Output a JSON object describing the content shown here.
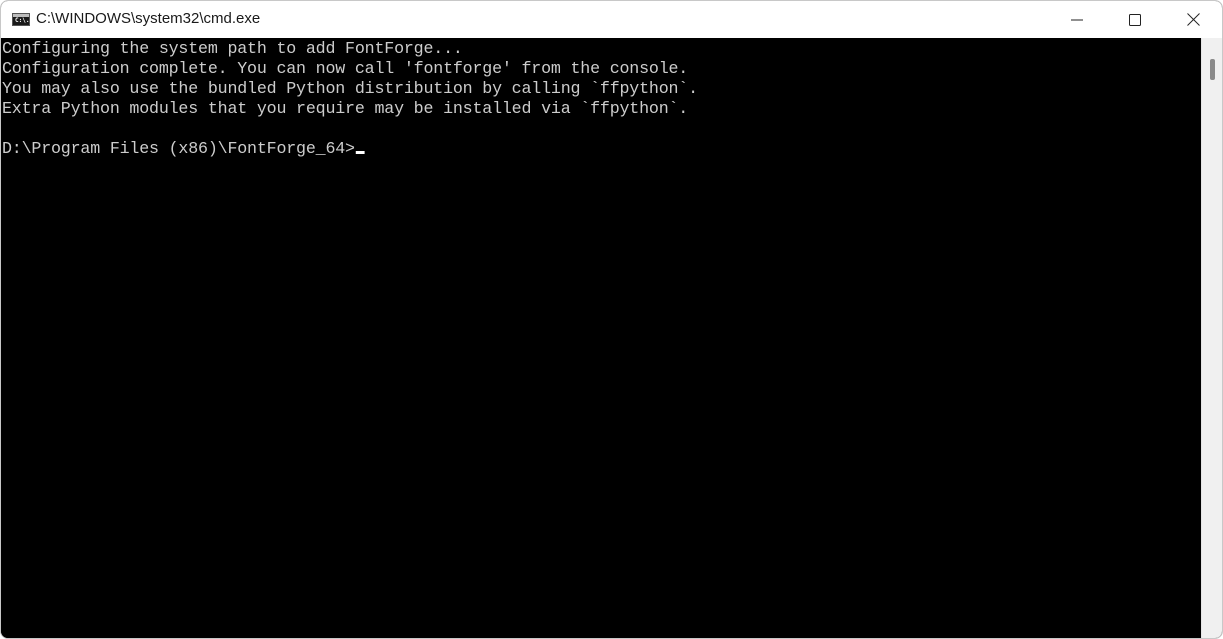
{
  "window": {
    "title": "C:\\WINDOWS\\system32\\cmd.exe",
    "app_icon": "cmd-app-icon",
    "app_icon_text": "C:\\.",
    "controls": {
      "minimize": "minimize-icon",
      "maximize": "maximize-icon",
      "close": "close-icon"
    }
  },
  "console": {
    "lines": [
      "Configuring the system path to add FontForge...",
      "Configuration complete. You can now call 'fontforge' from the console.",
      "You may also use the bundled Python distribution by calling `ffpython`.",
      "Extra Python modules that you require may be installed via `ffpython`.",
      ""
    ],
    "prompt": "D:\\Program Files (x86)\\FontForge_64>",
    "input": ""
  },
  "colors": {
    "background": "#000000",
    "text": "#cccccc",
    "titlebar": "#ffffff"
  }
}
